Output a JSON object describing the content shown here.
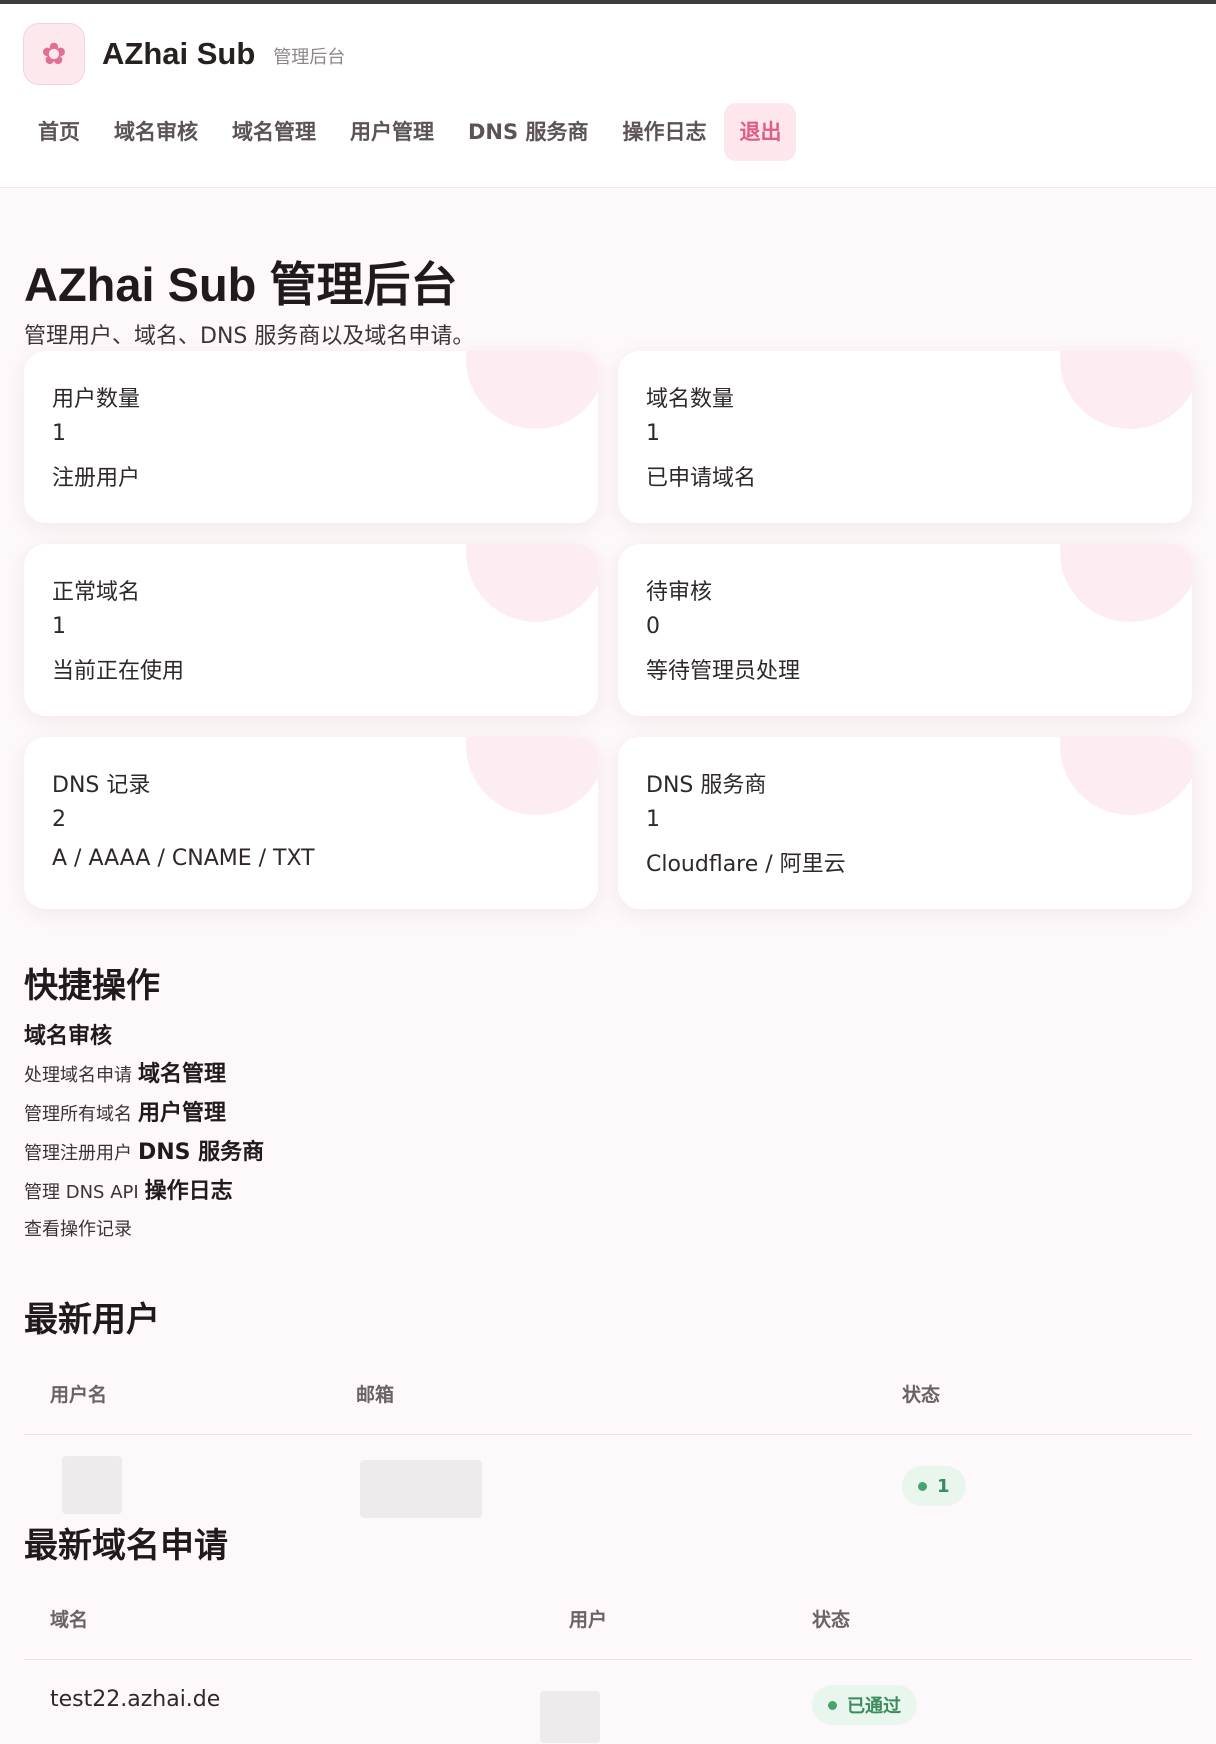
{
  "brand": {
    "name": "AZhai Sub",
    "subtitle": "管理后台",
    "logo_icon": "sakura-icon"
  },
  "nav": {
    "items": [
      {
        "label": "首页"
      },
      {
        "label": "域名审核"
      },
      {
        "label": "域名管理"
      },
      {
        "label": "用户管理"
      },
      {
        "label": "DNS 服务商"
      },
      {
        "label": "操作日志"
      }
    ],
    "logout_label": "退出"
  },
  "page": {
    "title": "AZhai Sub 管理后台",
    "description": "管理用户、域名、DNS 服务商以及域名申请。"
  },
  "stats": [
    {
      "label": "用户数量",
      "value": "1",
      "note": "注册用户"
    },
    {
      "label": "域名数量",
      "value": "1",
      "note": "已申请域名"
    },
    {
      "label": "正常域名",
      "value": "1",
      "note": "当前正在使用"
    },
    {
      "label": "待审核",
      "value": "0",
      "note": "等待管理员处理"
    },
    {
      "label": "DNS 记录",
      "value": "2",
      "note": "A / AAAA / CNAME / TXT"
    },
    {
      "label": "DNS 服务商",
      "value": "1",
      "note": "Cloudflare / 阿里云"
    }
  ],
  "quick": {
    "title": "快捷操作",
    "first_link": "域名审核",
    "lines": [
      {
        "desc": "处理域名申请",
        "link": "域名管理"
      },
      {
        "desc": "管理所有域名",
        "link": "用户管理"
      },
      {
        "desc": "管理注册用户",
        "link": "DNS 服务商"
      },
      {
        "desc": "管理 DNS API",
        "link": "操作日志"
      }
    ],
    "last_desc": "查看操作记录"
  },
  "latest_users": {
    "title": "最新用户",
    "headers": {
      "username": "用户名",
      "email": "邮箱",
      "status": "状态"
    },
    "rows": [
      {
        "status": "1"
      }
    ]
  },
  "latest_domains": {
    "title": "最新域名申请",
    "headers": {
      "domain": "域名",
      "user": "用户",
      "status": "状态"
    },
    "rows": [
      {
        "domain": "test22.azhai.de",
        "status": "已通过"
      }
    ]
  },
  "colors": {
    "accent": "#e05d83",
    "accent_bg": "#fde6ec",
    "success": "#3a8c5b",
    "success_bg": "#e9f6ee"
  }
}
